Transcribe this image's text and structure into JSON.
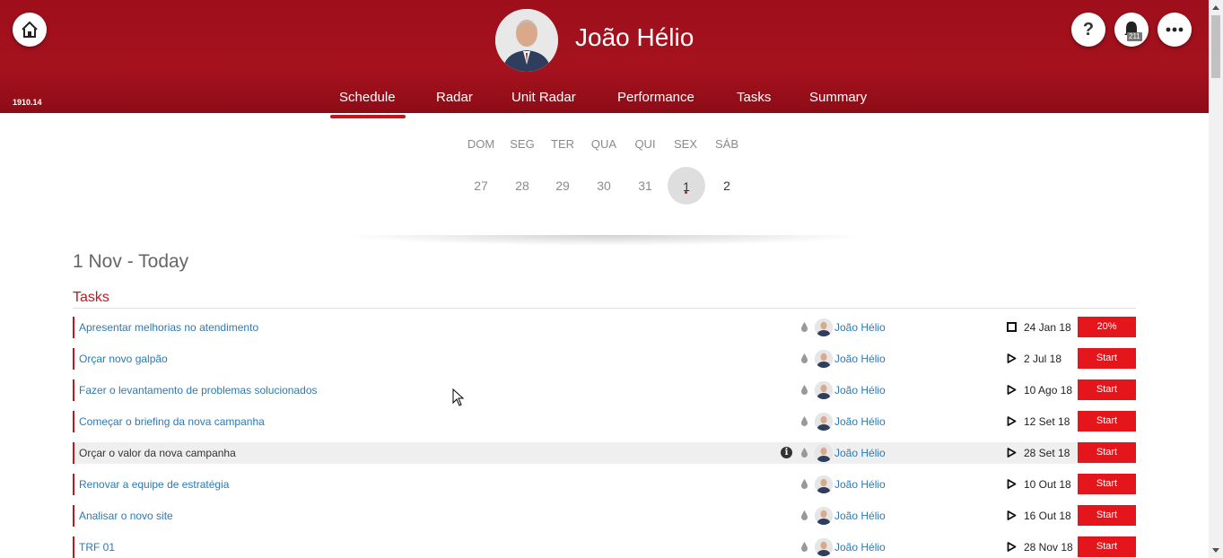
{
  "header": {
    "version": "1910.14",
    "user_name": "João Hélio",
    "help_label": "?",
    "notification_count": "211",
    "icons": [
      "home-icon",
      "help-icon",
      "bell-icon",
      "more-icon"
    ],
    "accent_color": "#a5121e"
  },
  "nav": {
    "tabs": [
      {
        "label": "Schedule",
        "active": true
      },
      {
        "label": "Radar"
      },
      {
        "label": "Unit Radar"
      },
      {
        "label": "Performance"
      },
      {
        "label": "Tasks"
      },
      {
        "label": "Summary"
      }
    ]
  },
  "calendar": {
    "days": [
      "DOM",
      "SEG",
      "TER",
      "QUA",
      "QUI",
      "SEX",
      "SÁB"
    ],
    "dates": [
      "27",
      "28",
      "29",
      "30",
      "31",
      "1",
      "2"
    ],
    "today_index": 5
  },
  "main": {
    "date_heading": "1 Nov - Today",
    "section_title": "Tasks",
    "tasks": [
      {
        "name": "Apresentar melhorias no atendimento",
        "owner": "João Hélio",
        "status_icon": "square-icon",
        "due": "24 Jan 18",
        "action": "20%",
        "info": false,
        "highlight": false
      },
      {
        "name": "Orçar novo galpão",
        "owner": "João Hélio",
        "status_icon": "play-icon",
        "due": "2 Jul 18",
        "action": "Start",
        "info": false,
        "highlight": false
      },
      {
        "name": "Fazer o levantamento de problemas solucionados",
        "owner": "João Hélio",
        "status_icon": "play-icon",
        "due": "10 Ago 18",
        "action": "Start",
        "info": false,
        "highlight": false
      },
      {
        "name": "Começar o briefing da nova campanha",
        "owner": "João Hélio",
        "status_icon": "play-icon",
        "due": "12 Set 18",
        "action": "Start",
        "info": false,
        "highlight": false
      },
      {
        "name": "Orçar o valor da nova campanha",
        "owner": "João Hélio",
        "status_icon": "play-icon",
        "due": "28 Set 18",
        "action": "Start",
        "info": true,
        "highlight": true
      },
      {
        "name": "Renovar a equipe de estratégia",
        "owner": "João Hélio",
        "status_icon": "play-icon",
        "due": "10 Out 18",
        "action": "Start",
        "info": false,
        "highlight": false
      },
      {
        "name": "Analisar o novo site",
        "owner": "João Hélio",
        "status_icon": "play-icon",
        "due": "16 Out 18",
        "action": "Start",
        "info": false,
        "highlight": false
      },
      {
        "name": "TRF 01",
        "owner": "João Hélio",
        "status_icon": "play-icon",
        "due": "28 Nov 18",
        "action": "Start",
        "info": false,
        "highlight": false
      }
    ]
  }
}
